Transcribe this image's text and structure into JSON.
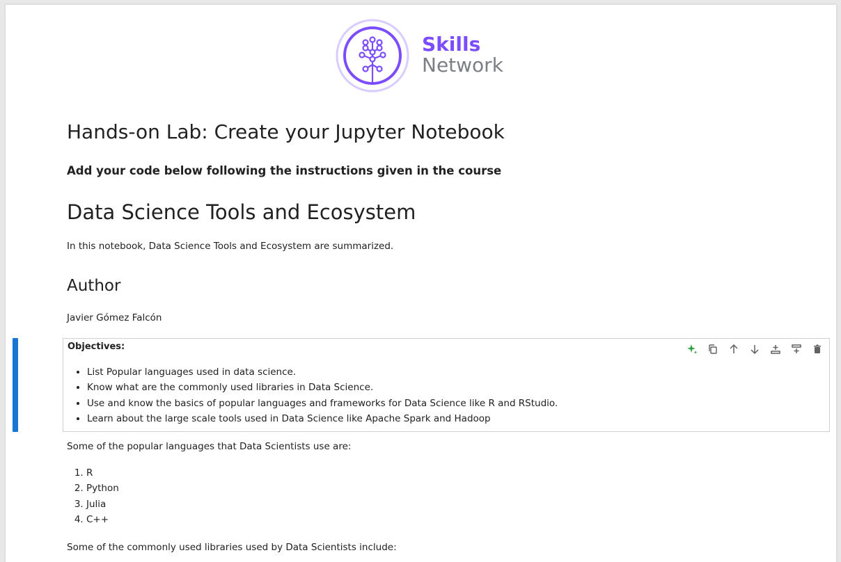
{
  "logo": {
    "line1": "Skills",
    "line2": "Network",
    "accent_color": "#7c4dff"
  },
  "content": {
    "title": "Hands-on Lab: Create your Jupyter Notebook",
    "subtitle": "Add your code below following the instructions given in the course",
    "heading": "Data Science Tools and Ecosystem",
    "intro": "In this notebook, Data Science Tools and Ecosystem are summarized.",
    "author_heading": "Author",
    "author_name": "Javier Gómez Falcón"
  },
  "active_cell": {
    "title": "Objectives:",
    "items": [
      "List Popular languages used in data science.",
      "Know what are the commonly used libraries in Data Science.",
      "Use and know the basics of popular languages and frameworks for Data Science like R and RStudio.",
      "Learn about the large scale tools used in Data Science like Apache Spark and Hadoop"
    ],
    "toolbar_icons": [
      "sparkle-ai-icon",
      "duplicate-icon",
      "move-up-icon",
      "move-down-icon",
      "insert-above-icon",
      "insert-below-icon",
      "delete-icon"
    ],
    "bar_color": "#1976d2"
  },
  "languages": {
    "intro": "Some of the popular languages that Data Scientists use are:",
    "items": [
      "R",
      "Python",
      "Julia",
      "C++"
    ]
  },
  "libraries": {
    "intro": "Some of the commonly used libraries used by Data Scientists include:"
  }
}
